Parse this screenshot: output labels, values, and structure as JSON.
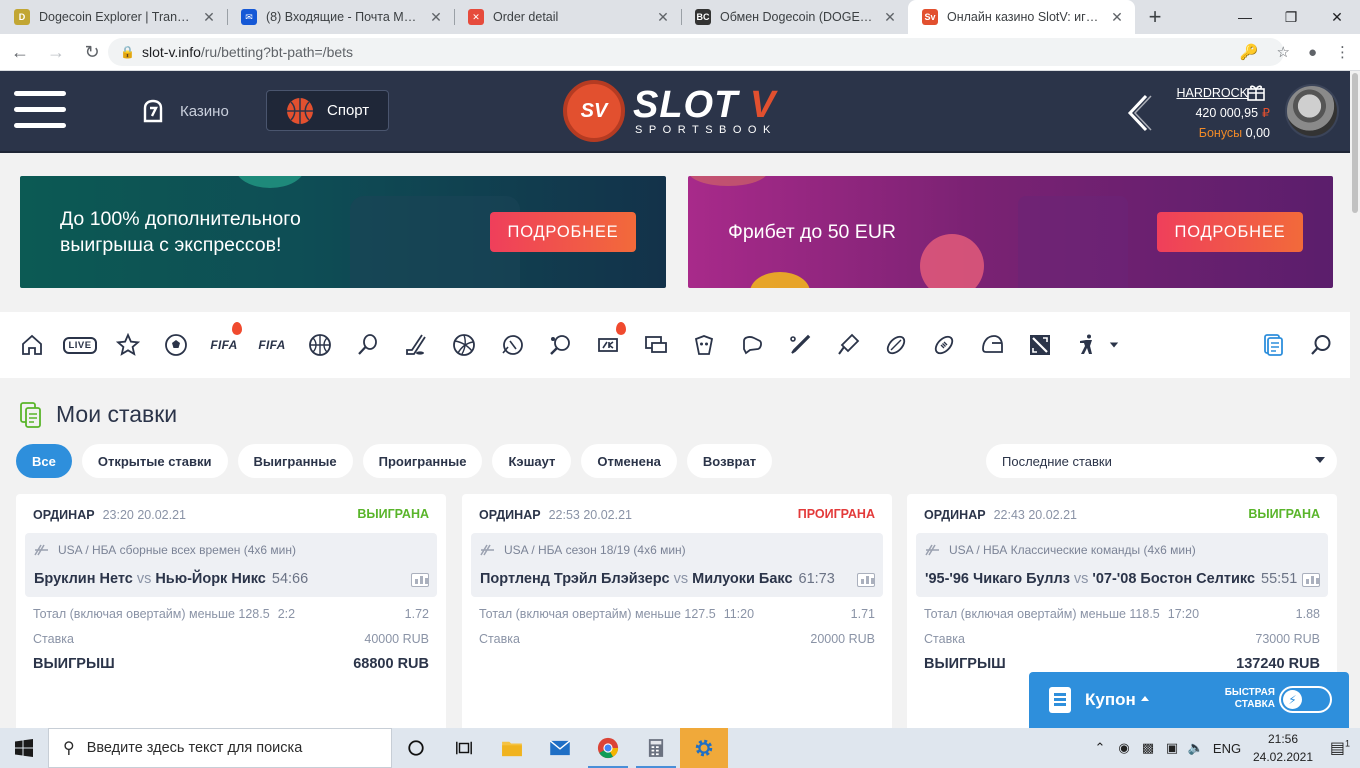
{
  "browser": {
    "tabs": [
      {
        "title": "Dogecoin Explorer | Transactio",
        "icon_color": "#c2a633",
        "icon_glyph": "D",
        "active": false
      },
      {
        "title": "(8) Входящие - Почта Mail.ru",
        "icon_color": "#1558d6",
        "icon_glyph": "✉",
        "active": false
      },
      {
        "title": "Order detail",
        "icon_color": "#e64b3c",
        "icon_glyph": "✕",
        "active": false
      },
      {
        "title": "Обмен Dogecoin (DOGE) на С",
        "icon_color": "#333333",
        "icon_glyph": "BC",
        "active": false
      },
      {
        "title": "Онлайн казино SlotV: играть",
        "icon_color": "#e2502f",
        "icon_glyph": "Sv",
        "active": true
      }
    ],
    "new_tab": "+",
    "url_domain": "slot-v.info",
    "url_path": "/ru/betting?bt-path=/bets"
  },
  "header": {
    "casino_label": "Казино",
    "sport_label": "Спорт",
    "logo_badge": "SV",
    "logo_word_a": "SLOT",
    "logo_word_b": "V",
    "logo_sub": "SPORTSBOOK",
    "username": "HARDROCK",
    "balance": "420 000,95",
    "currency_sign": "₽",
    "bonus_label": "Бонусы",
    "bonus_value": "0,00"
  },
  "banners": [
    {
      "text_line1": "До 100% дополнительного",
      "text_line2": "выигрыша с экспрессов!",
      "button": "ПОДРОБНЕЕ"
    },
    {
      "text_line1": "Фрибет до 50 EUR",
      "button": "ПОДРОБНЕЕ"
    }
  ],
  "sports_bar": {
    "live_label": "LIVE",
    "fifa_label": "FIFA"
  },
  "my_bets": {
    "title": "Мои ставки",
    "filters": [
      "Все",
      "Открытые ставки",
      "Выигранные",
      "Проигранные",
      "Кэшаут",
      "Отменена",
      "Возврат"
    ],
    "active_filter": "Все",
    "sort_selected": "Последние ставки"
  },
  "bets": [
    {
      "type": "ОРДИНАР",
      "datetime": "23:20 20.02.21",
      "status": "ВЫИГРАНА",
      "status_kind": "win",
      "league": "USA / НБА сборные всех времен (4х6 мин)",
      "team1": "Бруклин Нетс",
      "vs": "vs",
      "team2": "Нью-Йорк Никс",
      "score": "54:66",
      "market": "Тотал (включая овертайм) меньше 128.5",
      "market_score": "2:2",
      "odds": "1.72",
      "stake_label": "Ставка",
      "stake": "40000 RUB",
      "win_label": "ВЫИГРЫШ",
      "win": "68800 RUB"
    },
    {
      "type": "ОРДИНАР",
      "datetime": "22:53 20.02.21",
      "status": "ПРОИГРАНА",
      "status_kind": "lose",
      "league": "USA / НБА сезон 18/19 (4х6 мин)",
      "team1": "Портленд Трэйл Блэйзерс",
      "vs": "vs",
      "team2": "Милуоки Бакс",
      "score": "61:73",
      "market": "Тотал (включая овертайм) меньше 127.5",
      "market_score": "11:20",
      "odds": "1.71",
      "stake_label": "Ставка",
      "stake": "20000 RUB",
      "win_label": "",
      "win": ""
    },
    {
      "type": "ОРДИНАР",
      "datetime": "22:43 20.02.21",
      "status": "ВЫИГРАНА",
      "status_kind": "win",
      "league": "USA / НБА Классические команды (4х6 мин)",
      "team1": "'95-'96 Чикаго Буллз",
      "vs": "vs",
      "team2": "'07-'08 Бостон Селтикс",
      "score": "55:51",
      "market": "Тотал (включая овертайм) меньше 118.5",
      "market_score": "17:20",
      "odds": "1.88",
      "stake_label": "Ставка",
      "stake": "73000 RUB",
      "win_label": "ВЫИГРЫШ",
      "win": "137240 RUB"
    }
  ],
  "coupon": {
    "label": "Купон",
    "quick_line1": "БЫСТРАЯ",
    "quick_line2": "СТАВКА"
  },
  "taskbar": {
    "search_placeholder": "Введите здесь текст для поиска",
    "lang": "ENG",
    "time": "21:56",
    "date": "24.02.2021",
    "notif_count": "1"
  },
  "colors": {
    "header_bg": "#2b3449",
    "accent_orange": "#e2502f",
    "accent_blue": "#2e8fdc",
    "win_green": "#59b52a",
    "lose_red": "#e33a3a"
  }
}
